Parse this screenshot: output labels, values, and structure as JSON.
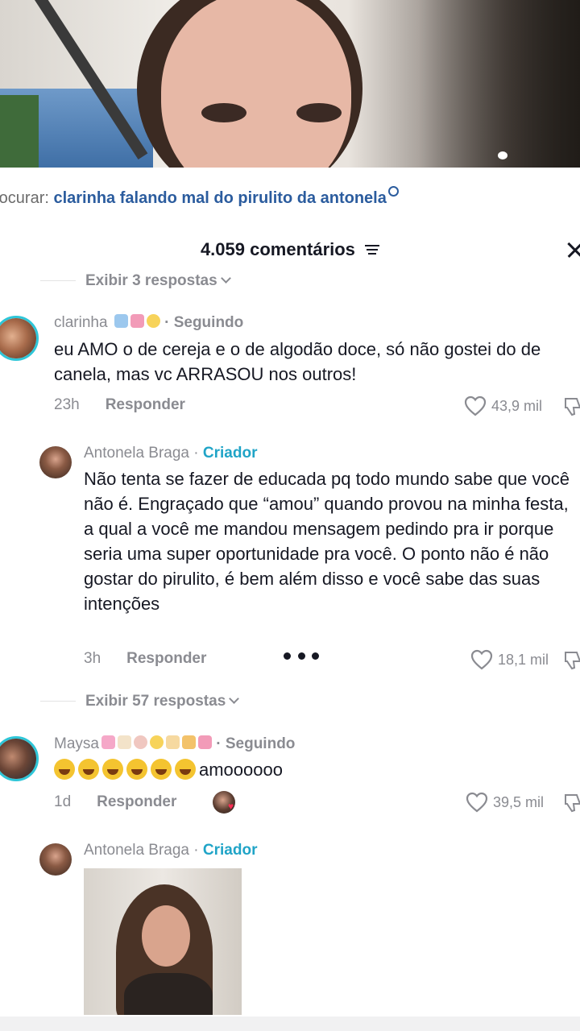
{
  "search": {
    "prefix": "rocurar:",
    "query": "clarinha falando mal do pirulito da antonela"
  },
  "comments_header": {
    "count_label": "4.059 comentários"
  },
  "thread1_top_replies_label": "Exibir 3 respostas",
  "comment1": {
    "username": "clarinha",
    "status": "· Seguindo",
    "text": "eu AMO o de cereja e o de algodão doce, só não gostei do de canela, mas vc ARRASOU nos outros!",
    "time": "23h",
    "reply_label": "Responder",
    "likes": "43,9 mil"
  },
  "reply1": {
    "username": "Antonela Braga",
    "badge": "Criador",
    "text": "Não tenta se fazer de educada pq todo mundo sabe que você não é. Engraçado que “amou” quando provou na minha festa, a qual a você me mandou mensagem pedindo pra ir porque seria uma super oportunidade pra você. O ponto não é não gostar do pirulito, é bem além disso e você sabe das suas intenções",
    "time": "3h",
    "reply_label": "Responder",
    "likes": "18,1 mil"
  },
  "thread1_more_replies_label": "Exibir 57 respostas",
  "comment2": {
    "username": "Maysa",
    "status": "· Seguindo",
    "text": "amoooooo",
    "time": "1d",
    "reply_label": "Responder",
    "likes": "39,5 mil"
  },
  "reply2": {
    "username": "Antonela Braga",
    "badge": "Criador"
  },
  "colors": {
    "accent": "#20a4c7",
    "search_query": "#2b5c9e",
    "muted": "#8a8b91",
    "text": "#161823",
    "avatar_ring": "#2ec6d8"
  },
  "icons": [
    "search-icon",
    "filter-icon",
    "close-icon",
    "heart-icon",
    "dislike-icon",
    "more-icon",
    "chevron-down-icon"
  ]
}
